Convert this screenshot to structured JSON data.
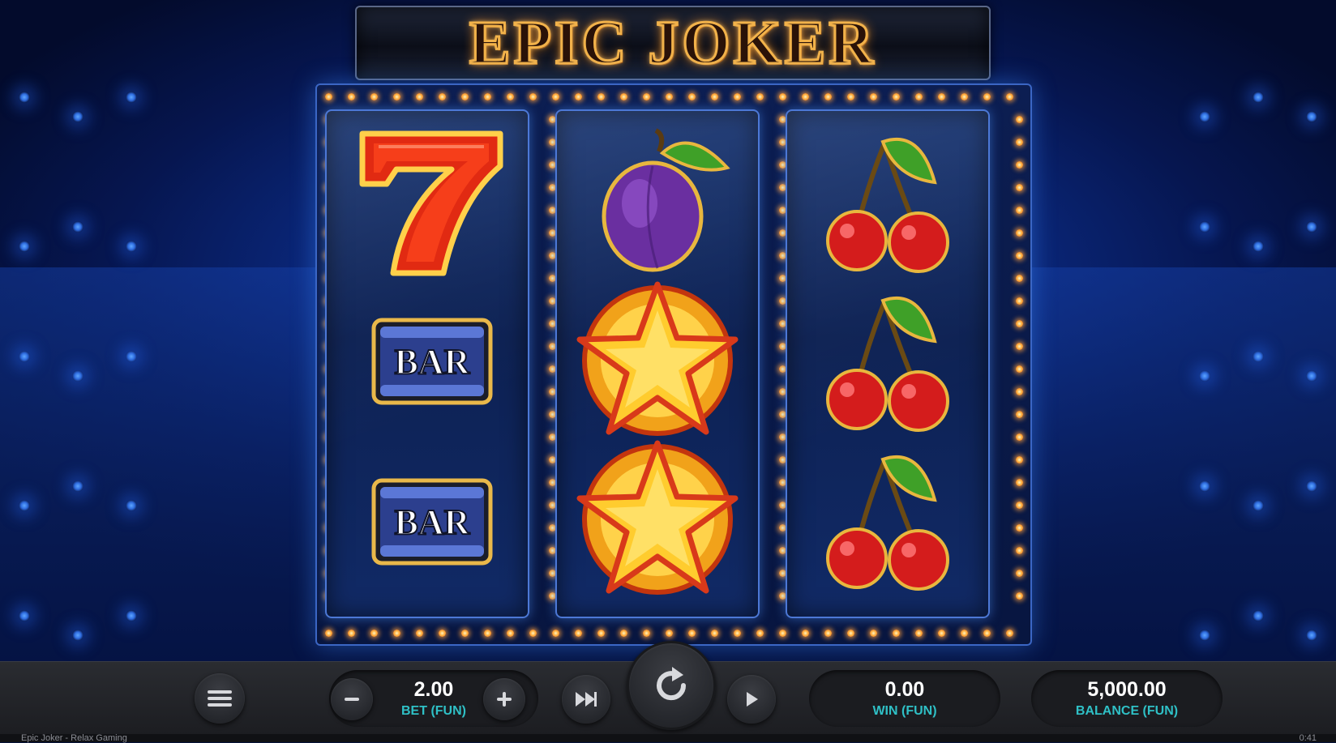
{
  "title": "EPIC JOKER",
  "reels": [
    [
      "seven",
      "bar",
      "bar"
    ],
    [
      "plum",
      "star",
      "star"
    ],
    [
      "cherry",
      "cherry",
      "cherry"
    ]
  ],
  "symbol_labels": {
    "bar": "BAR"
  },
  "controls": {
    "menu_icon": "hamburger-menu-icon",
    "bet_value": "2.00",
    "bet_label": "BET (FUN)",
    "decrease_icon": "minus-icon",
    "increase_icon": "plus-icon",
    "turbo_icon": "fast-forward-icon",
    "spin_icon": "refresh-spin-icon",
    "autoplay_icon": "play-icon",
    "win_value": "0.00",
    "win_label": "WIN (FUN)",
    "balance_value": "5,000.00",
    "balance_label": "BALANCE (FUN)"
  },
  "footer": {
    "left_text": "Epic Joker - Relax Gaming",
    "right_text": "0:41"
  },
  "colors": {
    "accent_teal": "#2fc0c6",
    "title_glow": "#f2b24a",
    "frame_blue": "#3b66c4"
  }
}
